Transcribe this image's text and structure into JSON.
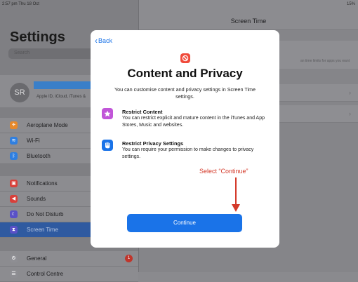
{
  "status": {
    "time": "2:57 pm  Thu 18 Oct",
    "battery": "15%"
  },
  "sidebar": {
    "title": "Settings",
    "search_placeholder": "Search",
    "profile": {
      "initials": "SR",
      "subtitle": "Apple ID, iCloud, iTunes &"
    },
    "group1": [
      {
        "label": "Aeroplane Mode",
        "icon": "airplane-icon",
        "color": "#e7892b"
      },
      {
        "label": "Wi-Fi",
        "icon": "wifi-icon",
        "color": "#2f7fe0"
      },
      {
        "label": "Bluetooth",
        "icon": "bluetooth-icon",
        "color": "#2f7fe0"
      }
    ],
    "group2": [
      {
        "label": "Notifications",
        "icon": "notifications-icon",
        "color": "#d8403a"
      },
      {
        "label": "Sounds",
        "icon": "sounds-icon",
        "color": "#d8403a"
      },
      {
        "label": "Do Not Disturb",
        "icon": "moon-icon",
        "color": "#5a51c7"
      },
      {
        "label": "Screen Time",
        "icon": "hourglass-icon",
        "color": "#5a51c7"
      }
    ],
    "group3": [
      {
        "label": "General",
        "icon": "gear-icon",
        "color": "#8e8e93",
        "badge": "1"
      },
      {
        "label": "Control Centre",
        "icon": "control-centre-icon",
        "color": "#8e8e93"
      }
    ]
  },
  "detail": {
    "title": "Screen Time",
    "card_text": "an time limits for apps you want"
  },
  "modal": {
    "back_label": "Back",
    "title": "Content and Privacy",
    "subtitle": "You can customise content and privacy settings in Screen Time settings.",
    "features": [
      {
        "title": "Restrict Content",
        "desc": "You can restrict explicit and mature content in the iTunes and App Stores, Music and websites.",
        "icon": "star-icon",
        "color": "#c155d8"
      },
      {
        "title": "Restrict Privacy Settings",
        "desc": "You can require your permission to make changes to privacy settings.",
        "icon": "hand-icon",
        "color": "#1a73e8"
      }
    ],
    "annotation": "Select “Continue”",
    "continue_label": "Continue"
  }
}
